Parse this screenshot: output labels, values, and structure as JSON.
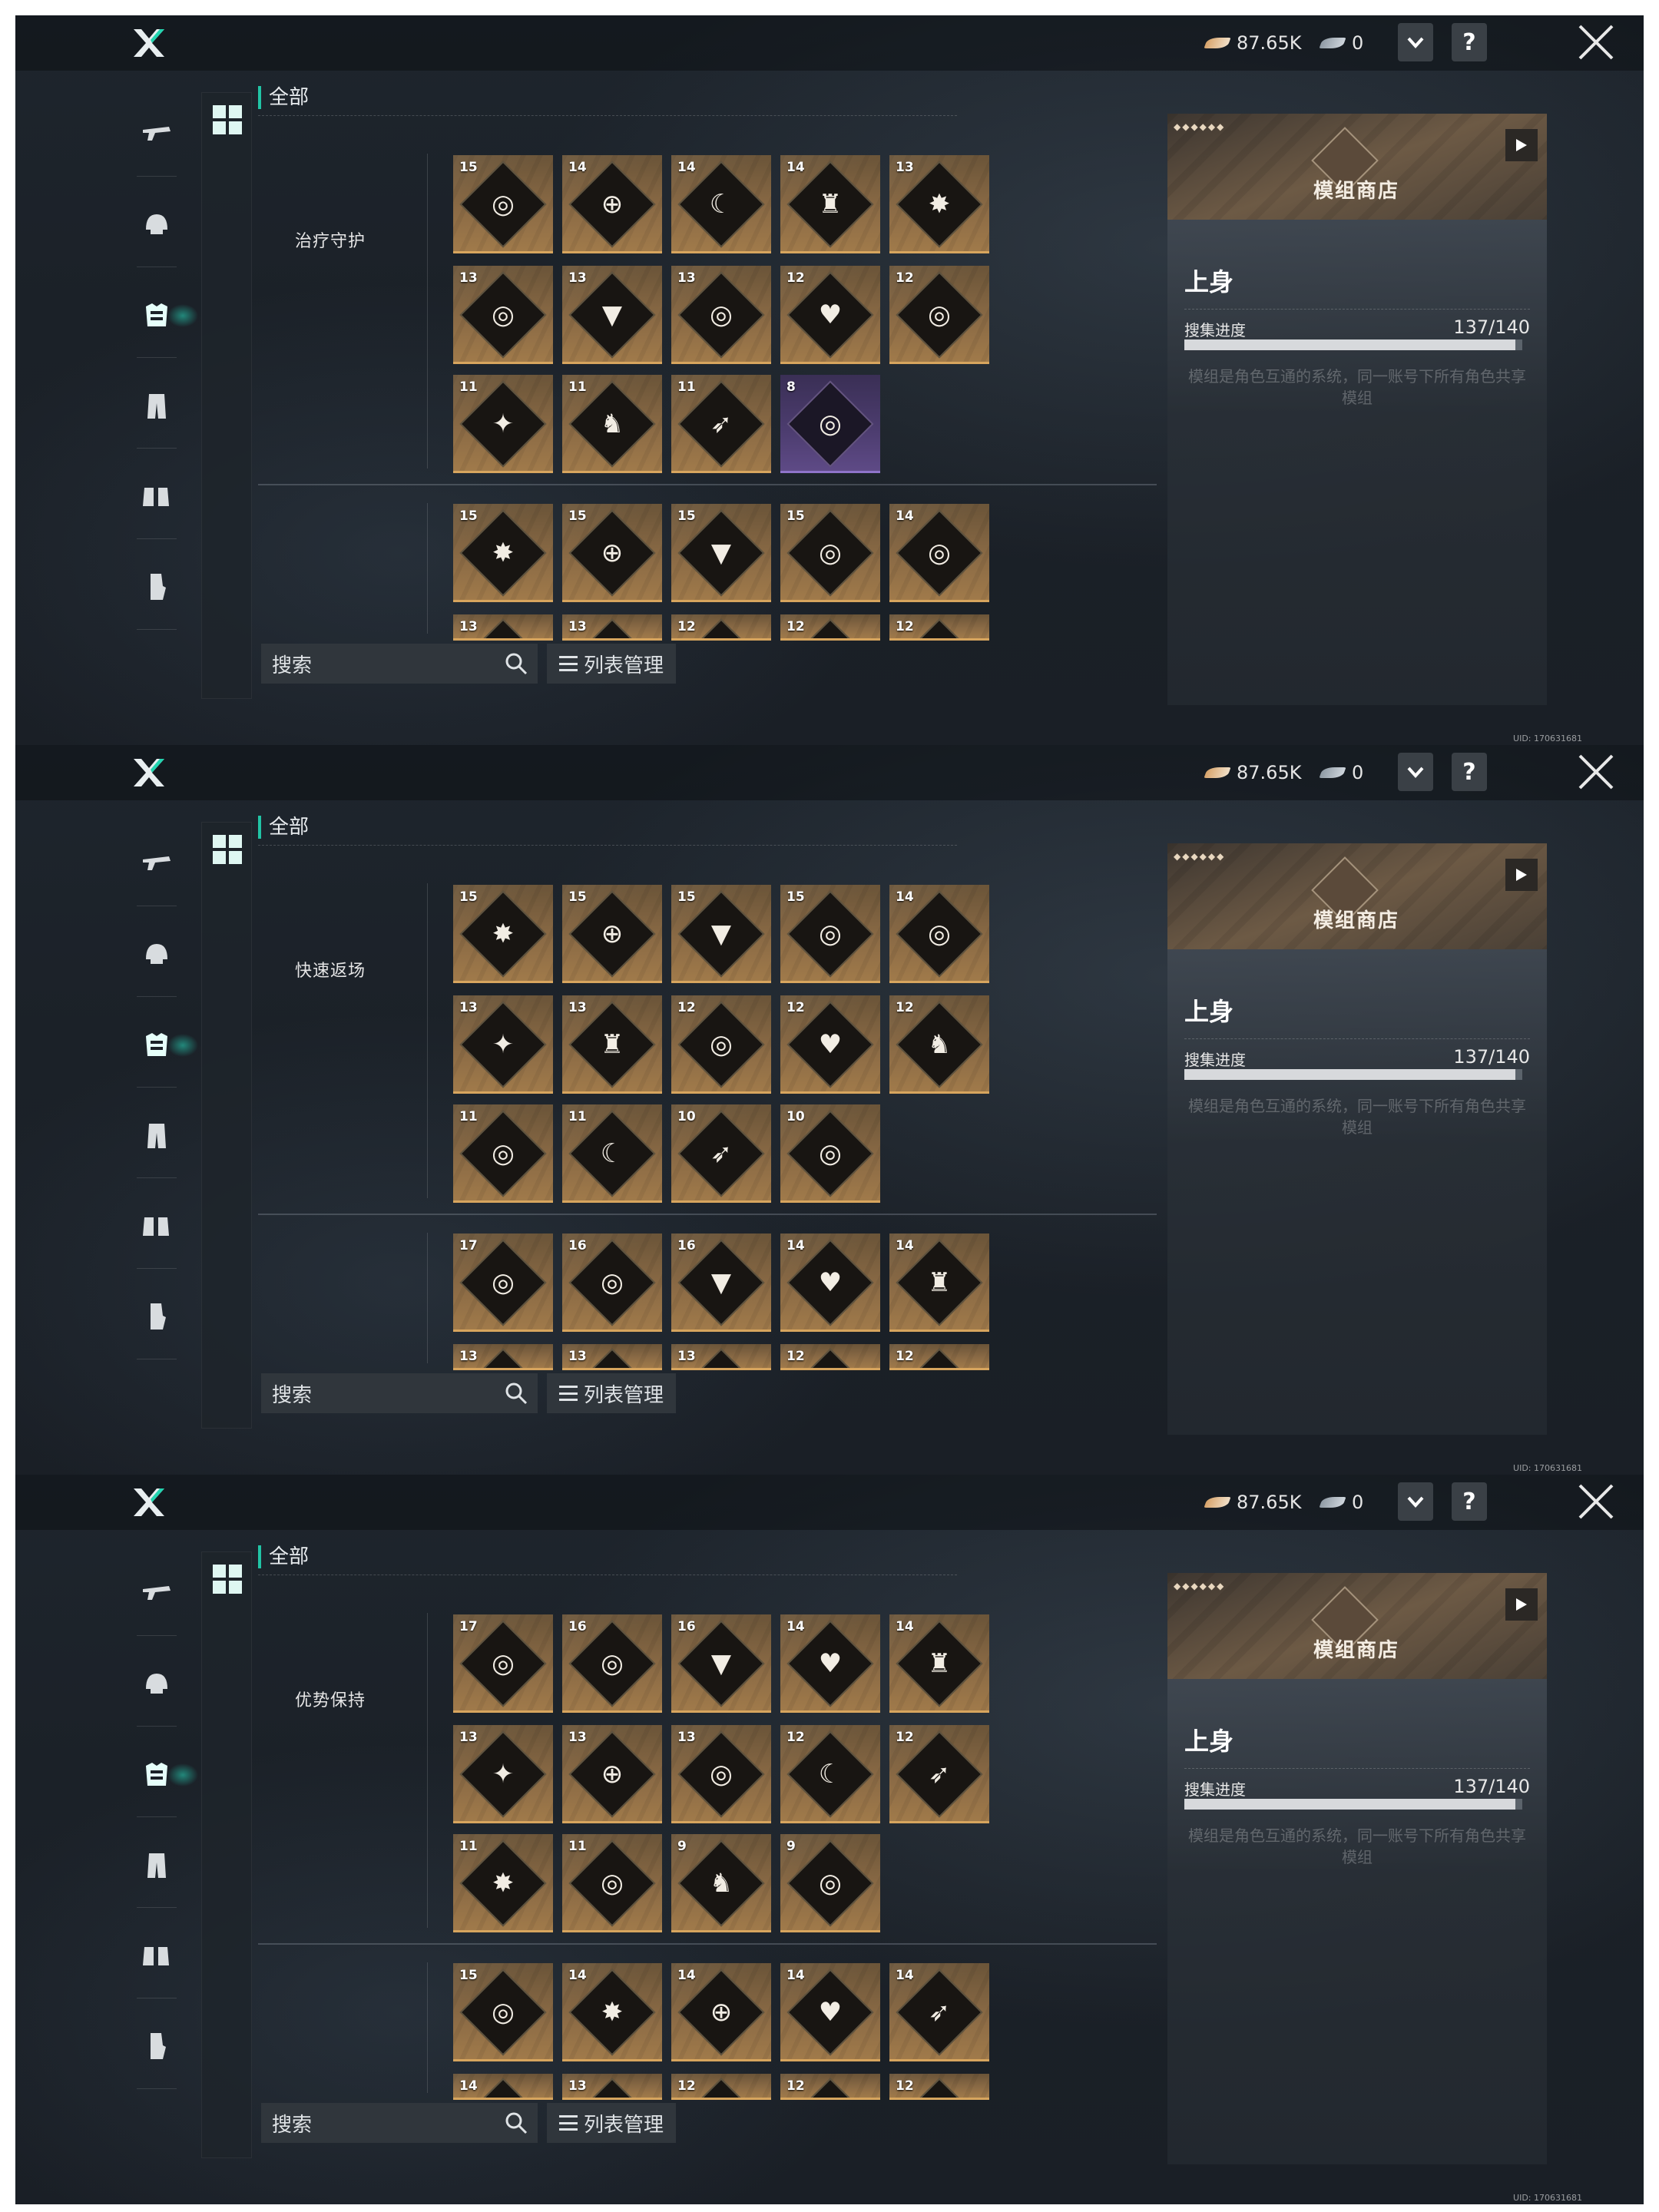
{
  "topbar": {
    "currency1": "87.65K",
    "currency2": "0",
    "help": "?"
  },
  "nav": {
    "items": [
      "gun-icon",
      "helmet-icon",
      "chest-armor-icon",
      "pants-icon",
      "boots-icon",
      "gloves-icon"
    ],
    "active": 2
  },
  "filter": {
    "all_label": "全部",
    "search_placeholder": "搜索",
    "list_label": "列表管理"
  },
  "shop": {
    "label": "模组商店",
    "gems": "◆◆◆◆◆◆"
  },
  "info": {
    "title": "上身",
    "watermark": "",
    "progress_label": "搜集进度",
    "progress_value": "137/140",
    "progress_fraction": 0.9786,
    "description": "模组是角色互通的系统，同一账号下所有角色共享模组"
  },
  "uid": "UID: 170631681",
  "screens": [
    {
      "group_name": "治疗守护",
      "rows": [
        [
          {
            "lvl": "15",
            "icon": "vortex-icon"
          },
          {
            "lvl": "14",
            "icon": "crosshair-icon"
          },
          {
            "lvl": "14",
            "icon": "moon-icon"
          },
          {
            "lvl": "14",
            "icon": "squad-icon"
          },
          {
            "lvl": "13",
            "icon": "explosion-icon"
          }
        ],
        [
          {
            "lvl": "13",
            "icon": "vortex-icon"
          },
          {
            "lvl": "13",
            "icon": "chevron-icon"
          },
          {
            "lvl": "13",
            "icon": "vortex-icon"
          },
          {
            "lvl": "12",
            "icon": "heart-pulse-icon"
          },
          {
            "lvl": "12",
            "icon": "vortex-icon"
          }
        ],
        [
          {
            "lvl": "11",
            "icon": "shield-break-icon"
          },
          {
            "lvl": "11",
            "icon": "soldier-icon"
          },
          {
            "lvl": "11",
            "icon": "bullet-icon"
          },
          {
            "lvl": "8",
            "icon": "vortex-icon",
            "purple": true
          }
        ]
      ],
      "second": [
        {
          "lvl": "15",
          "icon": "explosion-icon"
        },
        {
          "lvl": "15",
          "icon": "crosshair-icon"
        },
        {
          "lvl": "15",
          "icon": "chevron-icon"
        },
        {
          "lvl": "15",
          "icon": "vortex-icon"
        },
        {
          "lvl": "14",
          "icon": "vortex-icon"
        }
      ],
      "cut": [
        "13",
        "13",
        "12",
        "12",
        "12"
      ]
    },
    {
      "group_name": "快速返场",
      "rows": [
        [
          {
            "lvl": "15",
            "icon": "explosion-icon"
          },
          {
            "lvl": "15",
            "icon": "crosshair-icon"
          },
          {
            "lvl": "15",
            "icon": "chevron-icon"
          },
          {
            "lvl": "15",
            "icon": "vortex-icon"
          },
          {
            "lvl": "14",
            "icon": "vortex-icon"
          }
        ],
        [
          {
            "lvl": "13",
            "icon": "shield-break-icon"
          },
          {
            "lvl": "13",
            "icon": "squad-icon"
          },
          {
            "lvl": "12",
            "icon": "vortex-icon"
          },
          {
            "lvl": "12",
            "icon": "heart-pulse-icon"
          },
          {
            "lvl": "12",
            "icon": "soldier-icon"
          }
        ],
        [
          {
            "lvl": "11",
            "icon": "vortex-icon"
          },
          {
            "lvl": "11",
            "icon": "moon-icon"
          },
          {
            "lvl": "10",
            "icon": "bullet-icon"
          },
          {
            "lvl": "10",
            "icon": "vortex-icon"
          }
        ]
      ],
      "second": [
        {
          "lvl": "17",
          "icon": "vortex-icon"
        },
        {
          "lvl": "16",
          "icon": "vortex-icon"
        },
        {
          "lvl": "16",
          "icon": "chevron-icon"
        },
        {
          "lvl": "14",
          "icon": "heart-pulse-icon"
        },
        {
          "lvl": "14",
          "icon": "squad-icon"
        }
      ],
      "cut": [
        "13",
        "13",
        "13",
        "12",
        "12"
      ]
    },
    {
      "group_name": "优势保持",
      "rows": [
        [
          {
            "lvl": "17",
            "icon": "vortex-icon"
          },
          {
            "lvl": "16",
            "icon": "vortex-icon"
          },
          {
            "lvl": "16",
            "icon": "chevron-icon"
          },
          {
            "lvl": "14",
            "icon": "heart-pulse-icon"
          },
          {
            "lvl": "14",
            "icon": "squad-icon"
          }
        ],
        [
          {
            "lvl": "13",
            "icon": "shield-break-icon"
          },
          {
            "lvl": "13",
            "icon": "crosshair-icon"
          },
          {
            "lvl": "13",
            "icon": "vortex-icon"
          },
          {
            "lvl": "12",
            "icon": "moon-icon"
          },
          {
            "lvl": "12",
            "icon": "bullet-icon"
          }
        ],
        [
          {
            "lvl": "11",
            "icon": "explosion-icon"
          },
          {
            "lvl": "11",
            "icon": "vortex-icon"
          },
          {
            "lvl": "9",
            "icon": "soldier-icon"
          },
          {
            "lvl": "9",
            "icon": "vortex-icon"
          }
        ]
      ],
      "second": [
        {
          "lvl": "15",
          "icon": "vortex-icon"
        },
        {
          "lvl": "14",
          "icon": "explosion-icon"
        },
        {
          "lvl": "14",
          "icon": "crosshair-icon"
        },
        {
          "lvl": "14",
          "icon": "heart-pulse-icon"
        },
        {
          "lvl": "14",
          "icon": "bullet-icon"
        }
      ],
      "cut": [
        "14",
        "13",
        "12",
        "12",
        "12"
      ]
    }
  ]
}
